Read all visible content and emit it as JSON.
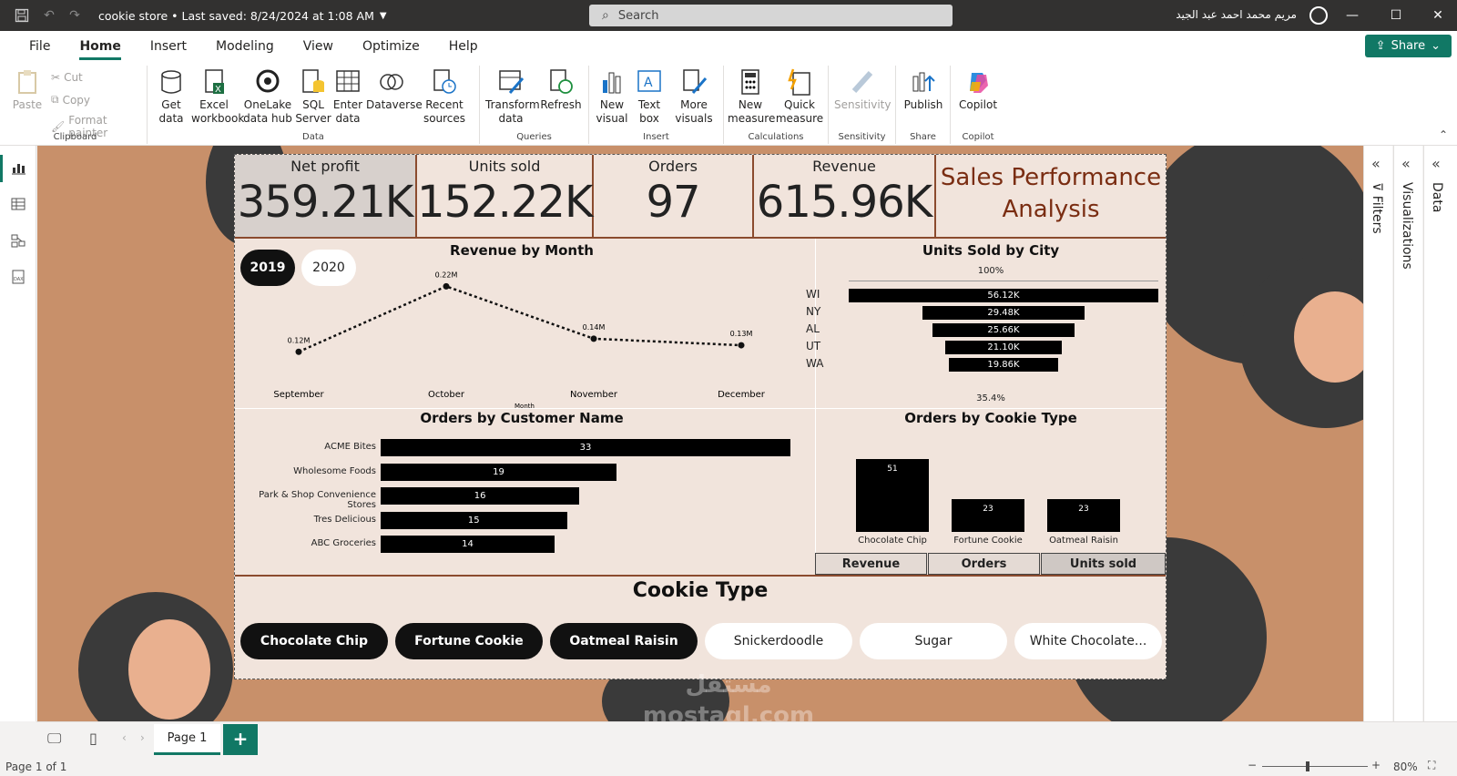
{
  "titlebar": {
    "title": "cookie store",
    "saved": "• Last saved: 8/24/2024 at 1:08 AM",
    "search_placeholder": "Search",
    "user": "مريم محمد احمد عبد الجيد"
  },
  "menu": {
    "tabs": [
      "File",
      "Home",
      "Insert",
      "Modeling",
      "View",
      "Optimize",
      "Help"
    ],
    "share": "Share"
  },
  "ribbon": {
    "clipboard": {
      "paste": "Paste",
      "cut": "Cut",
      "copy": "Copy",
      "format_painter": "Format painter",
      "label": "Clipboard"
    },
    "data": {
      "get_data": "Get data",
      "excel": "Excel workbook",
      "onelake": "OneLake data hub",
      "sql": "SQL Server",
      "enter": "Enter data",
      "dataverse": "Dataverse",
      "recent": "Recent sources",
      "label": "Data"
    },
    "queries": {
      "transform": "Transform data",
      "refresh": "Refresh",
      "label": "Queries"
    },
    "insert": {
      "new_visual": "New visual",
      "text_box": "Text box",
      "more_visuals": "More visuals",
      "label": "Insert"
    },
    "calculations": {
      "new_measure": "New measure",
      "quick_measure": "Quick measure",
      "label": "Calculations"
    },
    "sensitivity": {
      "btn": "Sensitivity",
      "label": "Sensitivity"
    },
    "share": {
      "publish": "Publish",
      "label": "Share"
    },
    "copilot": {
      "btn": "Copilot",
      "label": "Copilot"
    }
  },
  "panes": {
    "filters": "Filters",
    "visualizations": "Visualizations",
    "data": "Data"
  },
  "report": {
    "kpis": [
      {
        "label": "Net profit",
        "value": "359.21K"
      },
      {
        "label": "Units sold",
        "value": "152.22K"
      },
      {
        "label": "Orders",
        "value": "97"
      },
      {
        "label": "Revenue",
        "value": "615.96K"
      }
    ],
    "title_line1": "Sales Performance",
    "title_line2": "Analysis",
    "years": [
      "2019",
      "2020"
    ],
    "revenue_title": "Revenue by Month",
    "city_title": "Units Sold by City",
    "customer_title": "Orders by Customer Name",
    "cookie_type_chart_title": "Orders by Cookie Type",
    "measure_tabs": [
      "Revenue",
      "Orders",
      "Units sold"
    ],
    "slicer_title": "Cookie Type",
    "cookie_types": [
      "Chocolate Chip",
      "Fortune Cookie",
      "Oatmeal Raisin",
      "Snickerdoodle",
      "Sugar",
      "White Chocolate..."
    ],
    "funnel_top": "100%",
    "funnel_bottom": "35.4%"
  },
  "chart_data": [
    {
      "type": "line",
      "title": "Revenue by Month",
      "xlabel": "Month",
      "categories": [
        "September",
        "October",
        "November",
        "December"
      ],
      "values": [
        0.12,
        0.22,
        0.14,
        0.13
      ],
      "value_labels": [
        "0.12M",
        "0.22M",
        "0.14M",
        "0.13M"
      ],
      "ylim": [
        0.08,
        0.24
      ]
    },
    {
      "type": "bar",
      "title": "Units Sold by City",
      "categories": [
        "WI",
        "NY",
        "AL",
        "UT",
        "WA"
      ],
      "values": [
        56.12,
        29.48,
        25.66,
        21.1,
        19.86
      ],
      "value_labels": [
        "56.12K",
        "29.48K",
        "25.66K",
        "21.10K",
        "19.86K"
      ]
    },
    {
      "type": "bar",
      "title": "Orders by Customer Name",
      "categories": [
        "ACME Bites",
        "Wholesome Foods",
        "Park & Shop Convenience Stores",
        "Tres Delicious",
        "ABC Groceries"
      ],
      "values": [
        33,
        19,
        16,
        15,
        14
      ]
    },
    {
      "type": "bar",
      "title": "Orders by Cookie Type",
      "categories": [
        "Chocolate Chip",
        "Fortune Cookie",
        "Oatmeal Raisin"
      ],
      "values": [
        51,
        23,
        23
      ]
    }
  ],
  "pagebar": {
    "page": "Page 1",
    "status": "Page 1 of 1",
    "zoom": "80%"
  },
  "watermark": {
    "line1": "مستقل",
    "line2": "mostaql.com"
  }
}
